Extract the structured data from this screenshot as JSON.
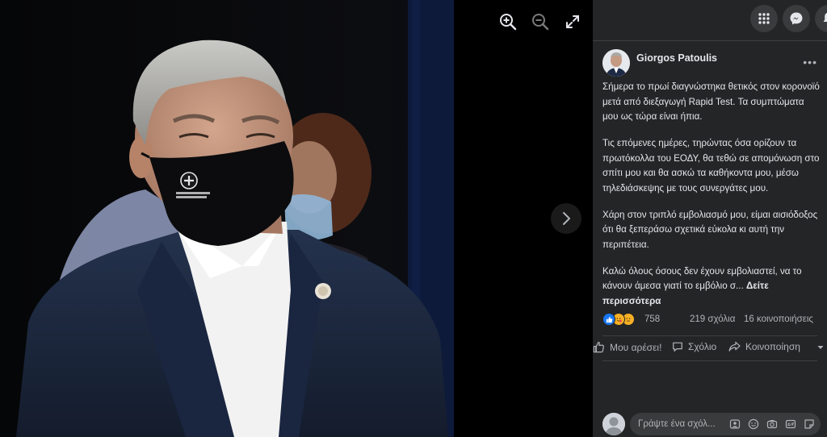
{
  "viewer": {
    "zoom_in": "zoom-in-icon",
    "zoom_out": "zoom-out-icon",
    "fullscreen": "fullscreen-icon",
    "next": "chevron-right-icon"
  },
  "topbar": {
    "menu_icon": "grid-menu-icon",
    "messenger_icon": "messenger-icon",
    "notifications_icon": "bell-icon"
  },
  "post": {
    "author": "Giorgos Patoulis",
    "more": "•••",
    "paragraphs": [
      "Σήμερα το πρωί διαγνώστηκα θετικός στον κορονοϊό μετά από διεξαγωγή Rapid Test. Τα συμπτώματα μου ως τώρα είναι ήπια.",
      "Τις επόμενες ημέρες, τηρώντας όσα ορίζουν τα πρωτόκολλα του ΕΟΔΥ, θα τεθώ σε απομόνωση στο σπίτι μου και θα ασκώ τα καθήκοντα μου, μέσω τηλεδιάσκεψης με τους συνεργάτες μου.",
      "Χάρη στον τριπλό εμβολιασμό μου, είμαι αισιόδοξος ότι θα ξεπεράσω σχετικά εύκολα κι αυτή την περιπέτεια.",
      "Καλώ όλους όσους δεν έχουν εμβολιαστεί, να το κάνουν άμεσα γιατί το εμβόλιο σ... "
    ],
    "see_more": "Δείτε περισσότερα",
    "reactions_count": "758",
    "comments": "219 σχόλια",
    "shares": "16 κοινοποιήσεις"
  },
  "actions": {
    "like": "Μου αρέσει!",
    "comment": "Σχόλιο",
    "share": "Κοινοποίηση"
  },
  "comment_box": {
    "placeholder": "Γράψτε ένα σχόλ..."
  },
  "colors": {
    "panel_bg": "#242526",
    "button_bg": "#3a3b3c",
    "text_primary": "#e4e6eb",
    "text_secondary": "#b0b3b8",
    "like_blue": "#1877f2"
  }
}
